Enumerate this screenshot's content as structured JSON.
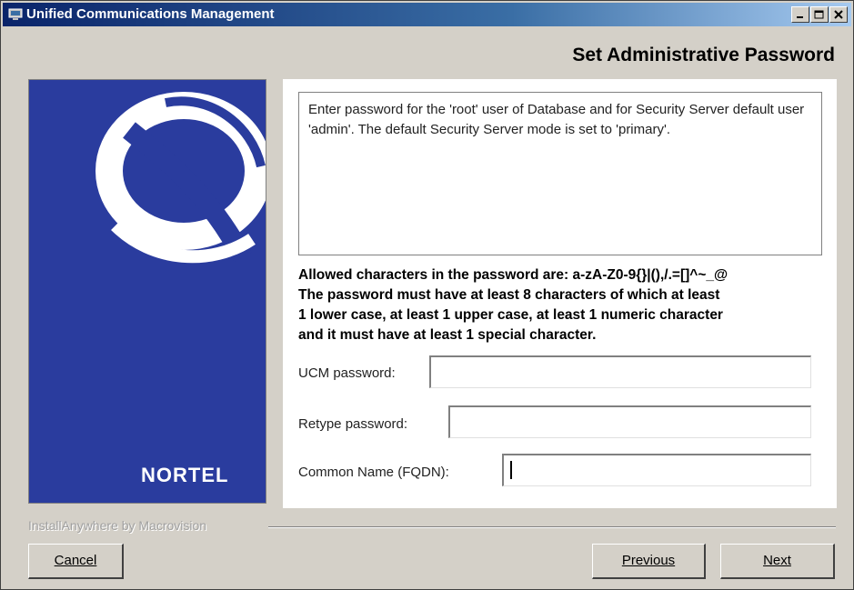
{
  "window": {
    "title": "Unified Communications Management",
    "controls": [
      "minimize",
      "maximize",
      "close"
    ]
  },
  "page": {
    "title": "Set Administrative Password"
  },
  "branding": {
    "logo_text": "NORTEL",
    "installer_text": "InstallAnywhere by Macrovision"
  },
  "description": "Enter password for the 'root' user of Database and for Security Server default user 'admin'. The default Security Server mode is set to 'primary'.",
  "rules": {
    "line1": "Allowed characters in the password are: a-zA-Z0-9{}|(),/.=[]^~_@",
    "line2": "The password must have at least 8 characters of which at least",
    "line3": "1 lower case, at least 1 upper case, at least 1 numeric character",
    "line4": "and it must have at least 1 special character."
  },
  "fields": {
    "ucm_password": {
      "label": "UCM password:",
      "value": ""
    },
    "retype_password": {
      "label": "Retype password:",
      "value": ""
    },
    "common_name": {
      "label": "Common Name (FQDN):",
      "value": ""
    }
  },
  "buttons": {
    "cancel": "Cancel",
    "previous": "Previous",
    "next": "Next"
  }
}
